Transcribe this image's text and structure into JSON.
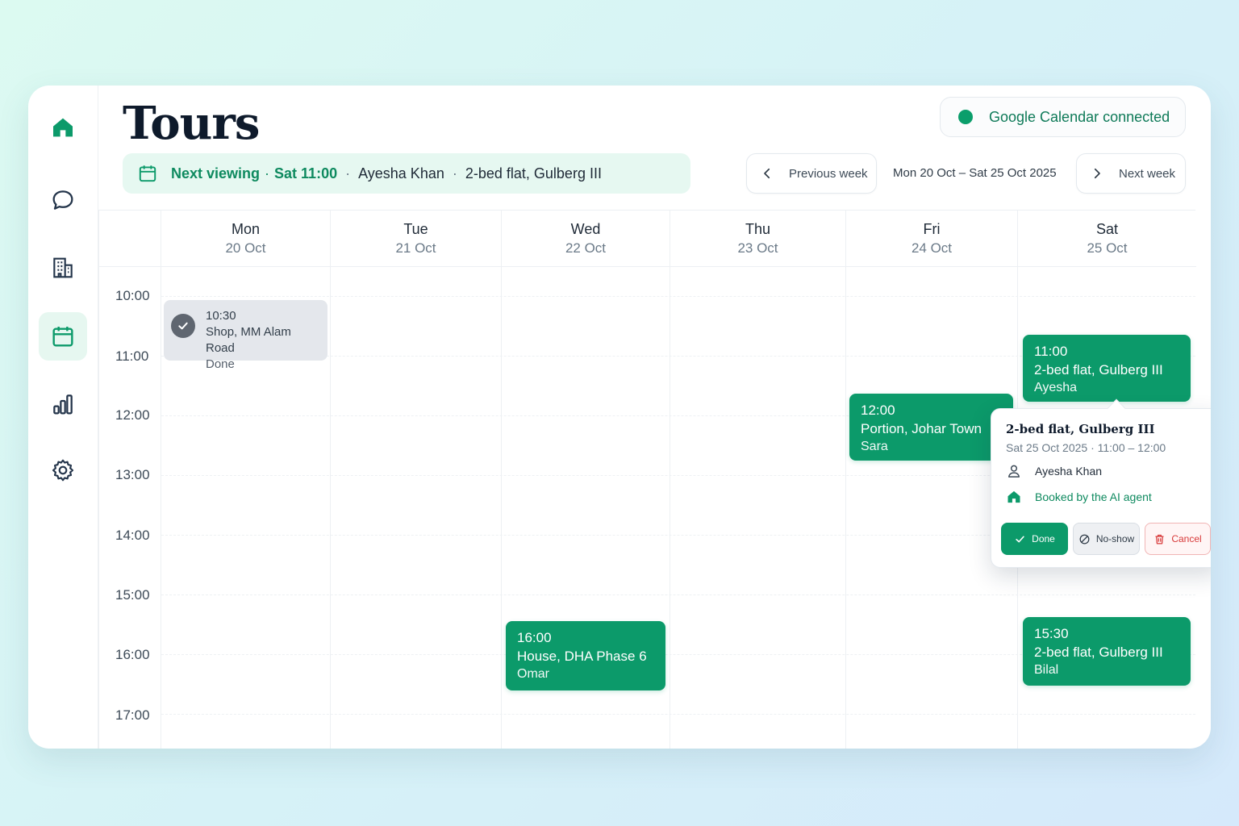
{
  "page": {
    "title": "Tours"
  },
  "sidebar": {
    "items": [
      {
        "name": "home",
        "icon": "home-icon",
        "active": false
      },
      {
        "name": "messages",
        "icon": "chat-icon",
        "active": false
      },
      {
        "name": "properties",
        "icon": "building-icon",
        "active": false
      },
      {
        "name": "calendar",
        "icon": "calendar-icon",
        "active": true
      },
      {
        "name": "analytics",
        "icon": "bar-chart-icon",
        "active": false
      },
      {
        "name": "settings",
        "icon": "gear-icon",
        "active": false
      }
    ]
  },
  "integration": {
    "label": "Google Calendar connected",
    "status_color": "#0b9e6b"
  },
  "next_viewing": {
    "label": "Next viewing",
    "time": "Sat 11:00",
    "person": "Ayesha Khan",
    "property": "2-bed flat, Gulberg III",
    "sep": "·"
  },
  "week_nav": {
    "prev_label": "Previous week",
    "range": "Mon 20 Oct – Sat 25 Oct 2025",
    "next_label": "Next week"
  },
  "calendar": {
    "days": [
      {
        "name": "Mon",
        "date": "20 Oct"
      },
      {
        "name": "Tue",
        "date": "21 Oct"
      },
      {
        "name": "Wed",
        "date": "22 Oct"
      },
      {
        "name": "Thu",
        "date": "23 Oct"
      },
      {
        "name": "Fri",
        "date": "24 Oct"
      },
      {
        "name": "Sat",
        "date": "25 Oct"
      }
    ],
    "hours": [
      "10:00",
      "11:00",
      "12:00",
      "13:00",
      "14:00",
      "15:00",
      "16:00",
      "17:00"
    ],
    "events": [
      {
        "time": "10:30",
        "place": "Shop, MM Alam Road",
        "status": "Done"
      },
      {
        "time": "12:00",
        "place": "Portion, Johar Town",
        "person": "Sara"
      },
      {
        "time": "11:00",
        "place": "2-bed flat, Gulberg III",
        "person": "Ayesha"
      },
      {
        "time": "16:00",
        "place": "House, DHA Phase 6",
        "person": "Omar"
      },
      {
        "time": "15:30",
        "place": "2-bed flat, Gulberg III",
        "person": "Bilal"
      }
    ]
  },
  "popover": {
    "title": "2-bed flat, Gulberg III",
    "datetime": "Sat 25 Oct 2025 · 11:00 – 12:00",
    "person": "Ayesha Khan",
    "booked_by": "Booked by the AI agent",
    "actions": {
      "done": "Done",
      "no_show": "No-show",
      "cancel": "Cancel"
    }
  },
  "colors": {
    "accent": "#0c9a6a",
    "danger": "#d83a3a",
    "done_bg": "#e4e7ec"
  }
}
